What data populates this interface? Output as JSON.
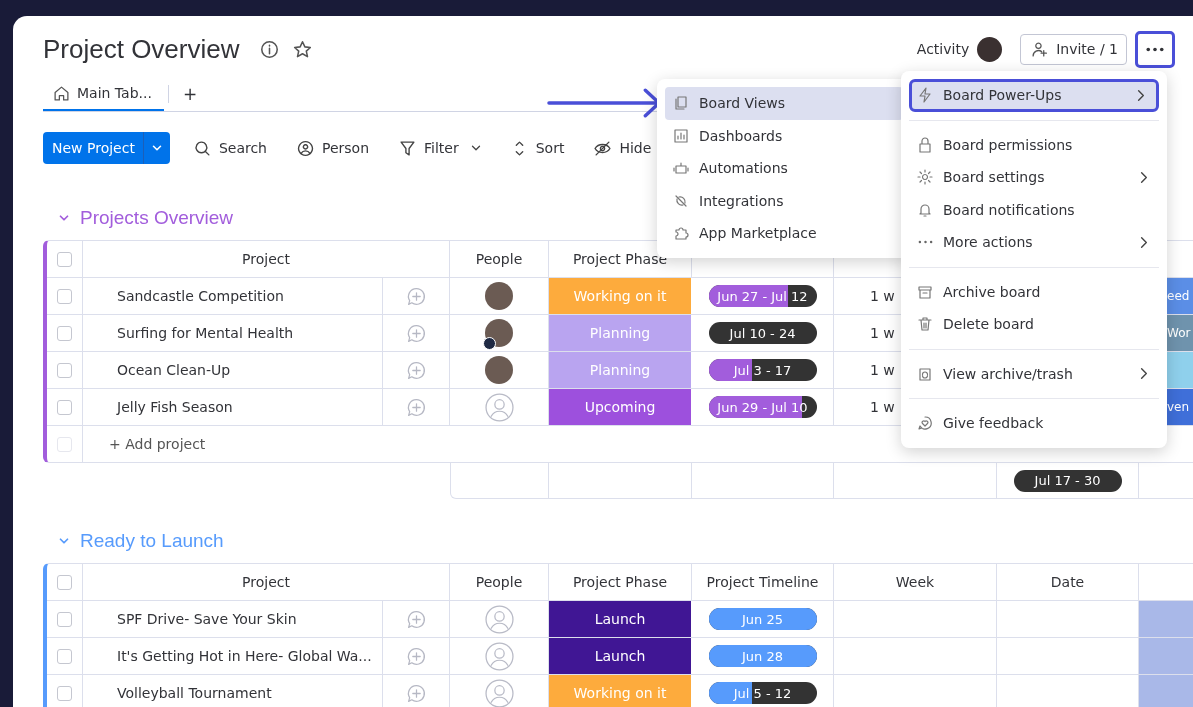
{
  "board": {
    "title": "Project Overview",
    "activity": "Activity",
    "invite": "Invite / 1",
    "more_annotated": true
  },
  "tabs": [
    {
      "label": "Main Tab...",
      "selected": true
    }
  ],
  "add_tab": "+",
  "toolbar": {
    "new_button": "New Project",
    "items": [
      {
        "kind": "search",
        "label": "Search"
      },
      {
        "kind": "person",
        "label": "Person"
      },
      {
        "kind": "filter",
        "label": "Filter"
      },
      {
        "kind": "sort",
        "label": "Sort"
      },
      {
        "kind": "hide",
        "label": "Hide"
      }
    ]
  },
  "groups": [
    {
      "title": "Projects Overview",
      "color": "#a25ddc",
      "all_checked": false,
      "columns": [
        "Project",
        "People",
        "Project Phase"
      ],
      "add_row": {
        "label": "+ Add project",
        "checked": false
      },
      "summary_date": "Jul 17 - 30",
      "rows": [
        {
          "checked": false,
          "name": "Sandcastle Competition",
          "person": {
            "kind": "photo",
            "home_badge": false
          },
          "phase": {
            "label": "Working on it",
            "color": "#fdab3d"
          },
          "timeline": {
            "label": "Jun 27 - Jul 12",
            "level": 0.74
          },
          "week": "1 w",
          "last": {
            "label": "eed",
            "color": "#5b8ee6"
          }
        },
        {
          "checked": false,
          "name": "Surfing for Mental Health",
          "person": {
            "kind": "photo",
            "home_badge": true
          },
          "phase": {
            "label": "Planning",
            "color": "#b9a4f0"
          },
          "timeline": {
            "label": "Jul 10 - 24"
          },
          "week": "1 w",
          "last": {
            "label": "Wor",
            "color": "#6f93ad"
          }
        },
        {
          "checked": false,
          "name": "Ocean Clean-Up",
          "person": {
            "kind": "photo",
            "home_badge": false
          },
          "phase": {
            "label": "Planning",
            "color": "#b9a4f0"
          },
          "timeline": {
            "label": "Jul 3 - 17",
            "level": 0.4
          },
          "week": "1 w",
          "last": {
            "color": "#8fd0ec"
          }
        },
        {
          "checked": false,
          "name": "Jelly Fish Season",
          "person": {
            "kind": "empty",
            "home_badge": false
          },
          "phase": {
            "label": "Upcoming",
            "color": "#9d50dd"
          },
          "timeline": {
            "label": "Jun 29 - Jul 10",
            "level": 0.87
          },
          "week": "1 w",
          "last": {
            "label": "ven",
            "color": "#3f6fd9"
          }
        }
      ]
    },
    {
      "title": "Ready to Launch",
      "color": "#579bfc",
      "all_checked": false,
      "columns": [
        "Project",
        "People",
        "Project Phase",
        "Project Timeline",
        "Week",
        "Date"
      ],
      "rows": [
        {
          "checked": false,
          "name": "SPF Drive- Save Your Skin",
          "person": {
            "kind": "empty",
            "home_badge": false
          },
          "phase": {
            "label": "Launch",
            "color": "#401694"
          },
          "timeline": {
            "label": "Jun 25",
            "level": 1
          },
          "last": {
            "color": "#a9b8e8"
          }
        },
        {
          "checked": false,
          "name": "It's Getting Hot in Here- Global Wa...",
          "person": {
            "kind": "empty",
            "home_badge": false
          },
          "phase": {
            "label": "Launch",
            "color": "#401694"
          },
          "timeline": {
            "label": "Jun 28",
            "level": 1
          },
          "last": {
            "color": "#a9b8e8"
          }
        },
        {
          "checked": false,
          "name": "Volleyball Tournament",
          "person": {
            "kind": "empty",
            "home_badge": false
          },
          "phase": {
            "label": "Working on it",
            "color": "#fdab3d"
          },
          "timeline": {
            "label": "Jul 5 - 12",
            "level": 0.4
          },
          "last": {
            "color": "#a9b8e8"
          }
        }
      ]
    }
  ],
  "views_menu": [
    {
      "label": "Board Views",
      "selected": true
    },
    {
      "label": "Dashboards",
      "selected": false
    },
    {
      "label": "Automations",
      "selected": false
    },
    {
      "label": "Integrations",
      "selected": false
    },
    {
      "label": "App Marketplace",
      "selected": false
    }
  ],
  "more_menu": [
    [
      {
        "label": "Board Power-Ups",
        "submenu": true,
        "selected": true,
        "annotated": true
      }
    ],
    [
      {
        "label": "Board permissions",
        "submenu": false,
        "selected": false,
        "annotated": false
      },
      {
        "label": "Board settings",
        "submenu": true,
        "selected": false,
        "annotated": false
      },
      {
        "label": "Board notifications",
        "submenu": false,
        "selected": false,
        "annotated": false
      },
      {
        "label": "More actions",
        "submenu": true,
        "selected": false,
        "annotated": false
      }
    ],
    [
      {
        "label": "Archive board",
        "submenu": false,
        "selected": false,
        "annotated": false
      },
      {
        "label": "Delete board",
        "submenu": false,
        "selected": false,
        "annotated": false
      }
    ],
    [
      {
        "label": "View archive/trash",
        "submenu": true,
        "selected": false,
        "annotated": false
      }
    ],
    [
      {
        "label": "Give feedback",
        "submenu": false,
        "selected": false,
        "annotated": false
      }
    ]
  ]
}
